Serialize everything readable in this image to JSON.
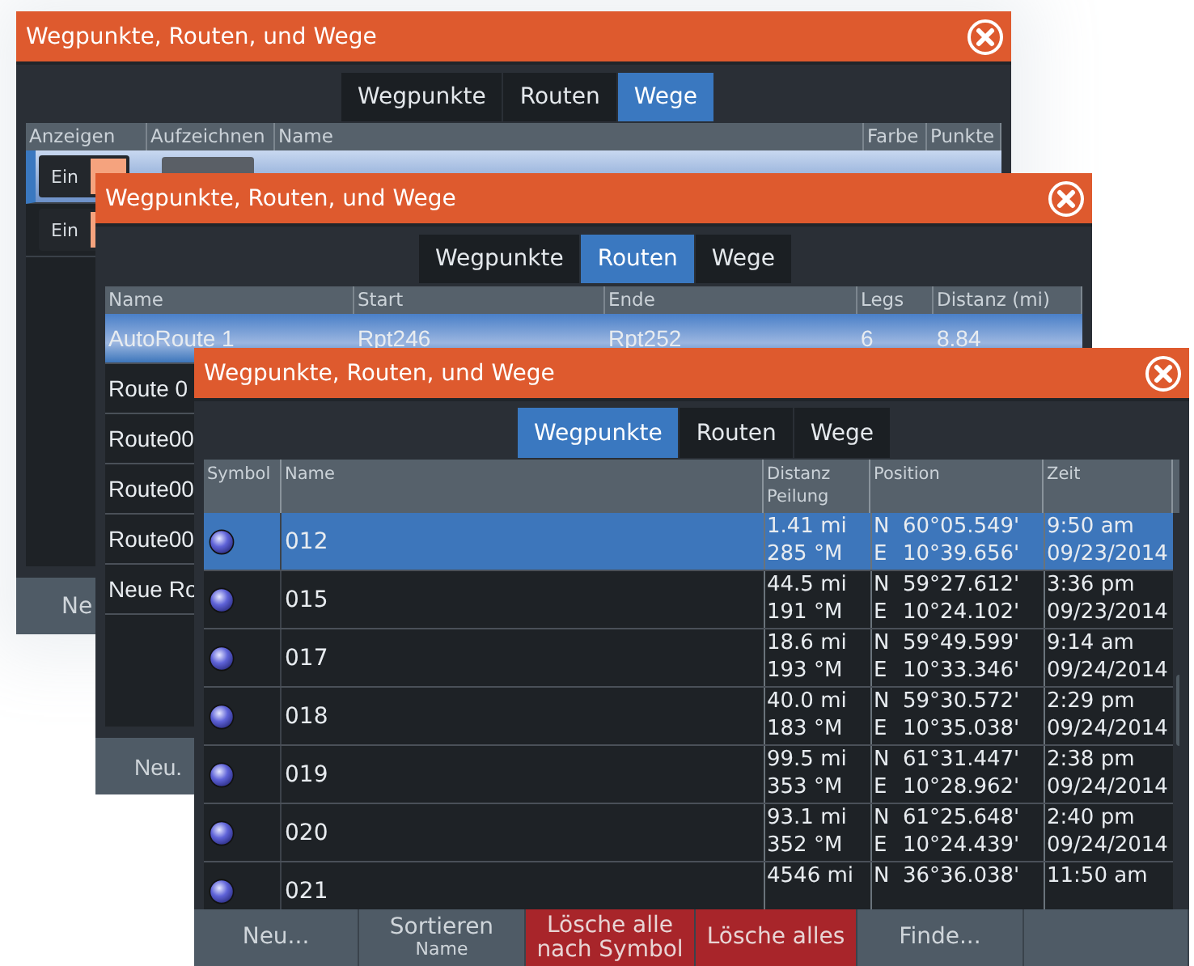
{
  "trails_window": {
    "title": "Wegpunkte, Routen, und Wege",
    "tabs": [
      {
        "label": "Wegpunkte",
        "selected": false
      },
      {
        "label": "Routen",
        "selected": false
      },
      {
        "label": "Wege",
        "selected": true
      }
    ],
    "columns": [
      "Anzeigen",
      "Aufzeichnen",
      "Name",
      "Farbe",
      "Punkte"
    ],
    "rows": [
      {
        "show": "Ein",
        "on": true,
        "selected": true
      },
      {
        "show": "Ein",
        "on": true,
        "selected": false
      }
    ],
    "buttons": [
      "Ne"
    ]
  },
  "routes_window": {
    "title": "Wegpunkte, Routen, und Wege",
    "tabs": [
      {
        "label": "Wegpunkte",
        "selected": false
      },
      {
        "label": "Routen",
        "selected": true
      },
      {
        "label": "Wege",
        "selected": false
      }
    ],
    "columns": [
      "Name",
      "Start",
      "Ende",
      "Legs",
      "Distanz (mi)"
    ],
    "rows": [
      {
        "name": "AutoRoute 1",
        "start": "Rpt246",
        "end": "Rpt252",
        "legs": "6",
        "distance": "8.84",
        "selected": true
      },
      {
        "name": "Route 0",
        "selected": false
      },
      {
        "name": "Route00",
        "selected": false
      },
      {
        "name": "Route00",
        "selected": false
      },
      {
        "name": "Route00",
        "selected": false
      },
      {
        "name": "Neue Ro",
        "selected": false
      }
    ],
    "buttons": [
      "Neu."
    ]
  },
  "waypoints_window": {
    "title": "Wegpunkte, Routen, und Wege",
    "tabs": [
      {
        "label": "Wegpunkte",
        "selected": true
      },
      {
        "label": "Routen",
        "selected": false
      },
      {
        "label": "Wege",
        "selected": false
      }
    ],
    "columns": [
      "Symbol",
      "Name",
      "Distanz\nPeilung",
      "Position",
      "Zeit"
    ],
    "rows": [
      {
        "name": "012",
        "distance": "1.41 mi",
        "bearing": "285 °M",
        "lat_dir": "N",
        "lat": "60°05.549'",
        "lon_dir": "E",
        "lon": "10°39.656'",
        "time": "9:50 am",
        "date": "09/23/2014",
        "selected": true
      },
      {
        "name": "015",
        "distance": "44.5 mi",
        "bearing": "191 °M",
        "lat_dir": "N",
        "lat": "59°27.612'",
        "lon_dir": "E",
        "lon": "10°24.102'",
        "time": "3:36 pm",
        "date": "09/23/2014",
        "selected": false
      },
      {
        "name": "017",
        "distance": "18.6 mi",
        "bearing": "193 °M",
        "lat_dir": "N",
        "lat": "59°49.599'",
        "lon_dir": "E",
        "lon": "10°33.346'",
        "time": "9:14 am",
        "date": "09/24/2014",
        "selected": false
      },
      {
        "name": "018",
        "distance": "40.0 mi",
        "bearing": "183 °M",
        "lat_dir": "N",
        "lat": "59°30.572'",
        "lon_dir": "E",
        "lon": "10°35.038'",
        "time": "2:29 pm",
        "date": "09/24/2014",
        "selected": false
      },
      {
        "name": "019",
        "distance": "99.5 mi",
        "bearing": "353 °M",
        "lat_dir": "N",
        "lat": "61°31.447'",
        "lon_dir": "E",
        "lon": "10°28.962'",
        "time": "2:38 pm",
        "date": "09/24/2014",
        "selected": false
      },
      {
        "name": "020",
        "distance": "93.1 mi",
        "bearing": "352 °M",
        "lat_dir": "N",
        "lat": "61°25.648'",
        "lon_dir": "E",
        "lon": "10°24.439'",
        "time": "2:40 pm",
        "date": "09/24/2014",
        "selected": false
      },
      {
        "name": "021",
        "distance": "4546 mi",
        "lat_dir": "N",
        "lat": "36°36.038'",
        "time": "11:50 am",
        "selected": false
      }
    ],
    "buttons": [
      {
        "label": "Neu...",
        "kind": "normal"
      },
      {
        "label": "Sortieren",
        "sublabel": "Name",
        "kind": "normal"
      },
      {
        "label": "Lösche alle nach Symbol",
        "kind": "danger"
      },
      {
        "label": "Lösche alles",
        "kind": "danger"
      },
      {
        "label": "Finde...",
        "kind": "normal"
      },
      {
        "kind": "empty"
      }
    ]
  }
}
